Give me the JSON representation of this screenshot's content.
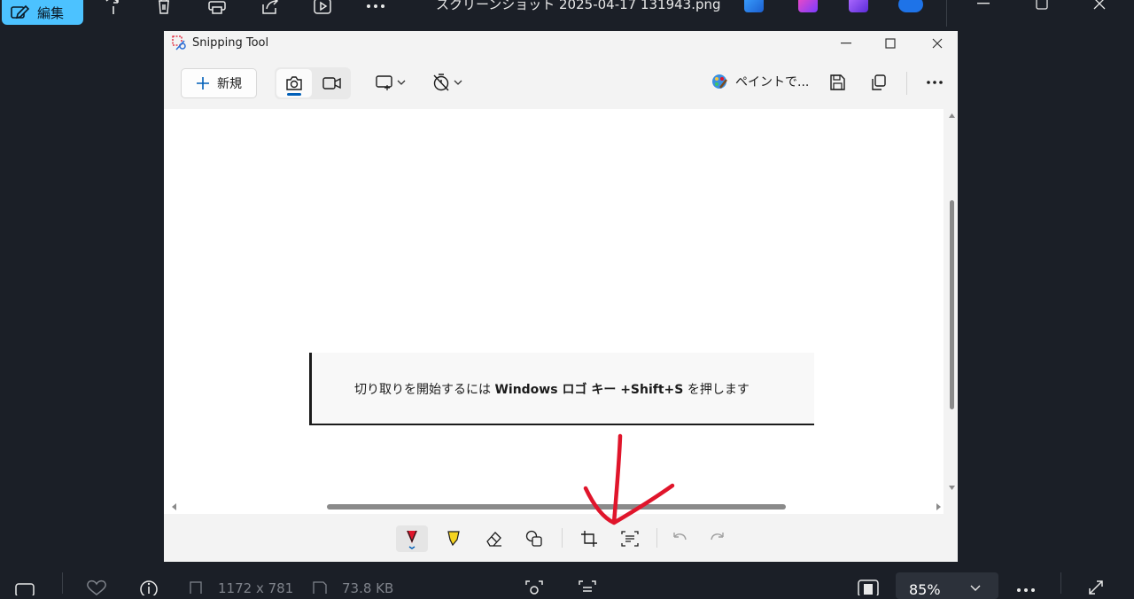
{
  "viewer": {
    "edit_label": "編集",
    "file_title": "スクリーンショット 2025-04-17 131943.png",
    "toolbar_icons": [
      "edit-pen-icon",
      "rotate-icon",
      "delete-icon",
      "print-icon",
      "share-icon",
      "slideshow-icon",
      "more-icon"
    ],
    "bottom": {
      "dimensions": "1172 x 781",
      "file_size": "73.8 KB",
      "zoom": "85%"
    }
  },
  "snipping": {
    "title": "Snipping Tool",
    "new_label": "新規",
    "paint_label": "ペイントで...",
    "hint": {
      "prefix": "切り取りを開始するには ",
      "bold": "Windows ロゴ キー +Shift+S",
      "suffix": " を押します"
    }
  },
  "colors": {
    "accent": "#4cc2ff",
    "annotation": "#e0152b",
    "viewer_bg": "#1b1f27",
    "snip_bg": "#f3f3f3"
  }
}
